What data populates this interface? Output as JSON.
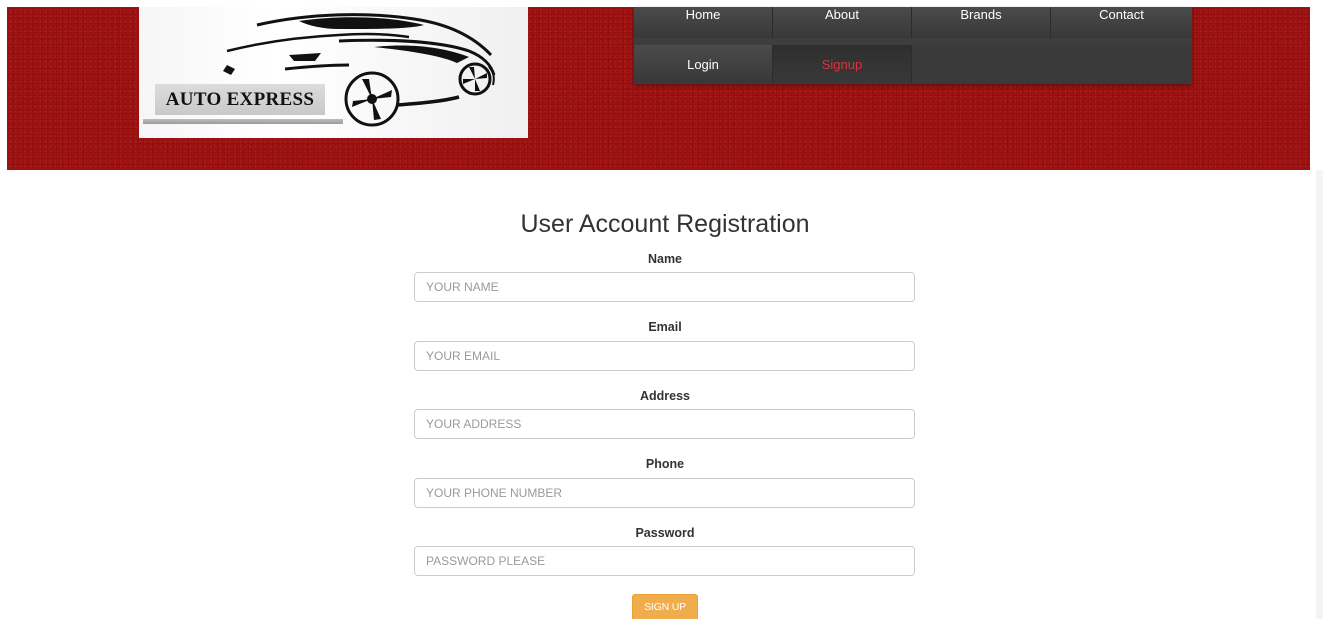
{
  "brand": {
    "logo_text": "AUTO EXPRESS"
  },
  "nav": {
    "items": [
      {
        "label": "Home",
        "active": false
      },
      {
        "label": "About",
        "active": false
      },
      {
        "label": "Brands",
        "active": false
      },
      {
        "label": "Contact",
        "active": false
      },
      {
        "label": "Login",
        "active": false
      },
      {
        "label": "Signup",
        "active": true
      }
    ],
    "active_color": "#e0323a"
  },
  "form": {
    "title": "User Account Registration",
    "fields": [
      {
        "label": "Name",
        "placeholder": "YOUR NAME",
        "value": ""
      },
      {
        "label": "Email",
        "placeholder": "YOUR EMAIL",
        "value": ""
      },
      {
        "label": "Address",
        "placeholder": "YOUR ADDRESS",
        "value": ""
      },
      {
        "label": "Phone",
        "placeholder": "YOUR PHONE NUMBER",
        "value": ""
      },
      {
        "label": "Password",
        "placeholder": "PASSWORD PLEASE",
        "value": ""
      }
    ],
    "submit_label": "SIGN UP"
  },
  "colors": {
    "header_red": "#a71212",
    "nav_bg": "#3e3e3e",
    "button_orange": "#f0ad4e"
  },
  "icons": {
    "logo": "car-silhouette-icon"
  }
}
